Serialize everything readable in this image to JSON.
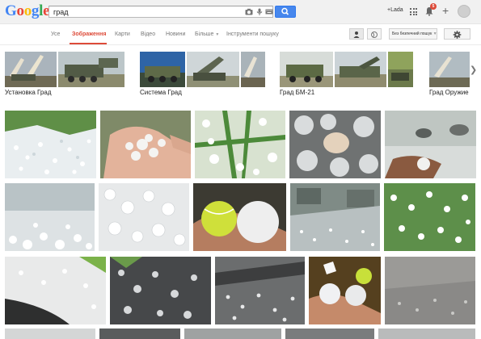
{
  "header": {
    "logo_text": "Google",
    "logo_colors": [
      "#4285f4",
      "#ea4335",
      "#fbbc05",
      "#4285f4",
      "#34a853",
      "#ea4335"
    ],
    "search_query": "град",
    "user_name": "+Lada",
    "notification_count": "5"
  },
  "tabs": [
    {
      "label": "Усе",
      "active": false
    },
    {
      "label": "Зображення",
      "active": true
    },
    {
      "label": "Карти",
      "active": false
    },
    {
      "label": "Відео",
      "active": false
    },
    {
      "label": "Новини",
      "active": false
    },
    {
      "label": "Більше",
      "active": false
    },
    {
      "label": "Інструменти пошуку",
      "active": false
    }
  ],
  "safe_search_label": "Без безпечний пошук",
  "related_searches": [
    {
      "label": "Установка Град"
    },
    {
      "label": "Система Град"
    },
    {
      "label": "Град БМ-21"
    },
    {
      "label": "Град Оружие"
    }
  ],
  "results": [
    {
      "subject": "hail-on-grass"
    },
    {
      "subject": "hailstones-in-hand"
    },
    {
      "subject": "hail-in-grass-closeup"
    },
    {
      "subject": "large-hailstones"
    },
    {
      "subject": "hail-storm-road"
    },
    {
      "subject": "hail-covered-field"
    },
    {
      "subject": "hail-pile"
    },
    {
      "subject": "hailstone-vs-tennis-ball"
    },
    {
      "subject": "hail-on-street"
    },
    {
      "subject": "hail-on-lawn"
    },
    {
      "subject": "hail-on-road-edge"
    },
    {
      "subject": "hail-on-pavement"
    },
    {
      "subject": "hail-on-asphalt"
    },
    {
      "subject": "hailstones-and-tennis-ball"
    },
    {
      "subject": "hail-on-ground"
    }
  ],
  "colors": {
    "accent": "#dd4b39",
    "search_button": "#4787ed"
  }
}
